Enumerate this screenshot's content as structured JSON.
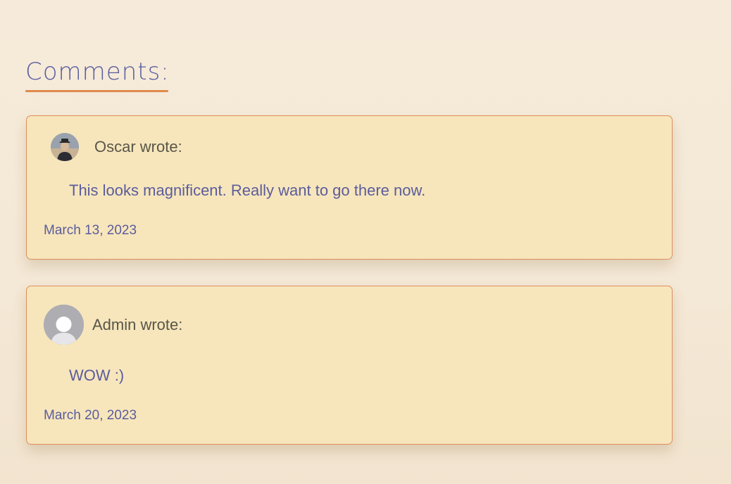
{
  "comments_section": {
    "heading": "Comments:",
    "comments": [
      {
        "author_line": "Oscar wrote:",
        "avatar": "user-photo-avatar",
        "text": "This looks magnificent. Really want to go there now.",
        "date": "March 13, 2023"
      },
      {
        "author_line": "Admin wrote:",
        "avatar": "default-user-avatar",
        "text": "WOW :)",
        "date": "March 20, 2023"
      }
    ]
  },
  "colors": {
    "background": "#f6ebda",
    "card_background": "#f7e6bc",
    "card_border": "#df8e5c",
    "heading_color": "#585e9e",
    "heading_underline": "#e0894e",
    "author_color": "#585648",
    "text_color": "#5b5c9c"
  }
}
